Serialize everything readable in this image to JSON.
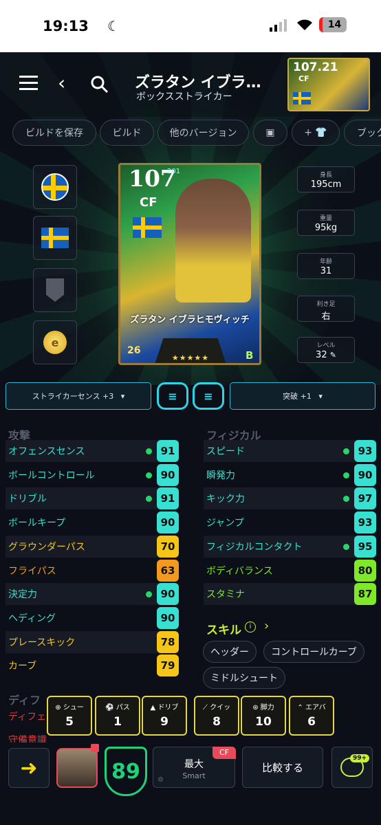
{
  "status": {
    "time": "19:13",
    "battery": "14"
  },
  "header": {
    "title": "ズラタン イブラ…",
    "subtitle": "ボックスストライカー",
    "thumb_rating": "107.21",
    "thumb_pos": "CF"
  },
  "tabs": [
    "ビルドを保存",
    "ビルド",
    "他のバージョン",
    "",
    "+",
    "ブック"
  ],
  "card": {
    "rating": "107",
    "rating_small": "201",
    "position": "CF",
    "name": "ズラタン イブラヒモヴィッチ",
    "number": "26",
    "rank": "B",
    "stars": "★★★★★"
  },
  "info": [
    {
      "label": "身長",
      "value": "195cm"
    },
    {
      "label": "重量",
      "value": "95kg"
    },
    {
      "label": "年齢",
      "value": "31"
    },
    {
      "label": "利き足",
      "value": "右"
    },
    {
      "label": "レベル",
      "value": "32"
    }
  ],
  "boost": {
    "left": "ストライカーセンス +3",
    "right": "突破 +1"
  },
  "attack": {
    "title": "攻撃",
    "stats": [
      {
        "name": "オフェンスセンス",
        "value": "91",
        "color": "#37e0d0",
        "dot": true,
        "nc": "#37e0d0"
      },
      {
        "name": "ボールコントロール",
        "value": "90",
        "color": "#37e0d0",
        "dot": true,
        "nc": "#37e0d0"
      },
      {
        "name": "ドリブル",
        "value": "91",
        "color": "#37e0d0",
        "dot": true,
        "nc": "#37e0d0"
      },
      {
        "name": "ボールキープ",
        "value": "90",
        "color": "#37e0d0",
        "dot": false,
        "nc": "#37e0d0"
      },
      {
        "name": "グラウンダーパス",
        "value": "70",
        "color": "#f5c518",
        "dot": false,
        "nc": "#f5c518"
      },
      {
        "name": "フライパス",
        "value": "63",
        "color": "#f39a1e",
        "dot": false,
        "nc": "#f39a1e"
      },
      {
        "name": "決定力",
        "value": "90",
        "color": "#37e0d0",
        "dot": true,
        "nc": "#37e0d0"
      },
      {
        "name": "ヘディング",
        "value": "90",
        "color": "#37e0d0",
        "dot": false,
        "nc": "#37e0d0"
      },
      {
        "name": "プレースキック",
        "value": "78",
        "color": "#f5c518",
        "dot": false,
        "nc": "#f5c518"
      },
      {
        "name": "カーブ",
        "value": "79",
        "color": "#f5c518",
        "dot": false,
        "nc": "#f5c518"
      }
    ]
  },
  "physical": {
    "title": "フィジカル",
    "stats": [
      {
        "name": "スピード",
        "value": "93",
        "color": "#37e0d0",
        "dot": true,
        "nc": "#37e0d0"
      },
      {
        "name": "瞬発力",
        "value": "90",
        "color": "#37e0d0",
        "dot": true,
        "nc": "#37e0d0"
      },
      {
        "name": "キック力",
        "value": "97",
        "color": "#37e0d0",
        "dot": true,
        "nc": "#37e0d0"
      },
      {
        "name": "ジャンプ",
        "value": "93",
        "color": "#37e0d0",
        "dot": false,
        "nc": "#37e0d0"
      },
      {
        "name": "フィジカルコンタクト",
        "value": "95",
        "color": "#37e0d0",
        "dot": true,
        "nc": "#37e0d0"
      },
      {
        "name": "ボディバランス",
        "value": "80",
        "color": "#7ee829",
        "dot": false,
        "nc": "#7ee829"
      },
      {
        "name": "スタミナ",
        "value": "87",
        "color": "#7ee829",
        "dot": false,
        "nc": "#7ee829"
      }
    ]
  },
  "skills": {
    "title": "スキル",
    "items": [
      "ヘッダー",
      "コントロールカーブ",
      "ミドルシュート"
    ]
  },
  "defense": {
    "title": "ディフ",
    "first": "ディフェ",
    "second": "守備意識"
  },
  "overview": [
    {
      "label": "シュー",
      "value": "5"
    },
    {
      "label": "パス",
      "value": "1"
    },
    {
      "label": "ドリブ",
      "value": "9"
    },
    {
      "label": "クイッ",
      "value": "8"
    },
    {
      "label": "脚力",
      "value": "10"
    },
    {
      "label": "エアバ",
      "value": "6"
    }
  ],
  "bottom": {
    "overall": "89",
    "max": "最大",
    "smart": "Smart",
    "cf": "CF",
    "compare": "比較する",
    "chat_badge": "99+"
  }
}
